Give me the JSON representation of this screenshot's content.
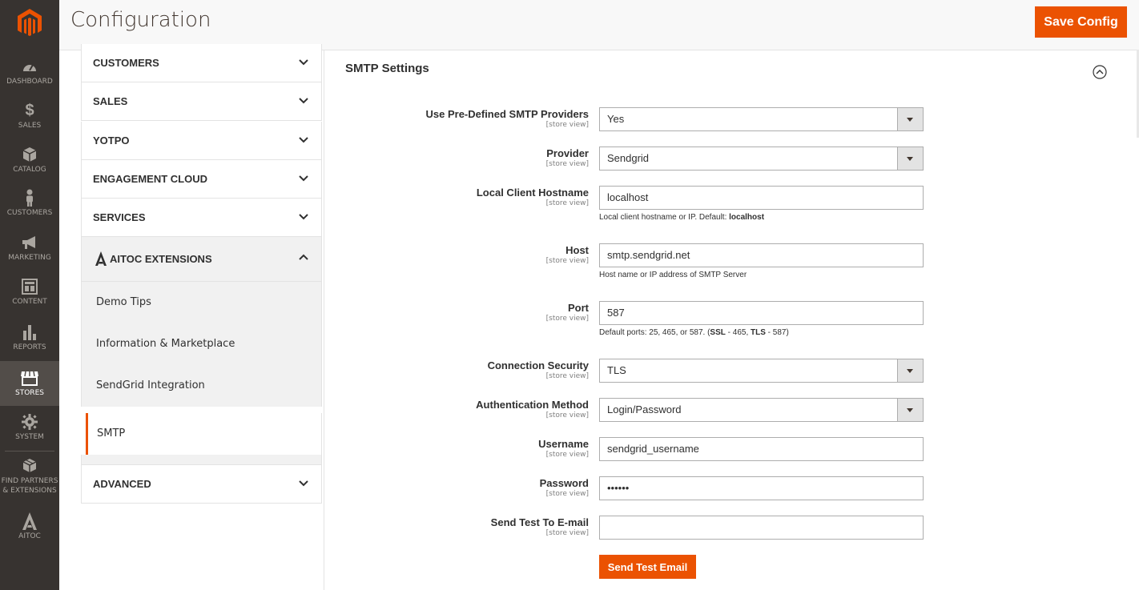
{
  "nav": {
    "items": [
      {
        "label": "DASHBOARD",
        "icon": "dashboard-icon"
      },
      {
        "label": "SALES",
        "icon": "dollar-icon"
      },
      {
        "label": "CATALOG",
        "icon": "cube-icon"
      },
      {
        "label": "CUSTOMERS",
        "icon": "person-icon"
      },
      {
        "label": "MARKETING",
        "icon": "megaphone-icon"
      },
      {
        "label": "CONTENT",
        "icon": "layout-icon"
      },
      {
        "label": "REPORTS",
        "icon": "bar-chart-icon"
      },
      {
        "label": "STORES",
        "icon": "store-icon"
      },
      {
        "label": "SYSTEM",
        "icon": "gear-icon"
      },
      {
        "label": "FIND PARTNERS & EXTENSIONS",
        "icon": "boxes-icon"
      },
      {
        "label": "AITOC",
        "icon": "aitoc-logo-icon"
      }
    ],
    "active": "STORES"
  },
  "header": {
    "title": "Configuration",
    "save_label": "Save Config"
  },
  "tabs": {
    "groups": [
      {
        "label": "CUSTOMERS",
        "state": "collapsed"
      },
      {
        "label": "SALES",
        "state": "collapsed"
      },
      {
        "label": "YOTPO",
        "state": "collapsed"
      },
      {
        "label": "ENGAGEMENT CLOUD",
        "state": "collapsed"
      },
      {
        "label": "SERVICES",
        "state": "collapsed"
      },
      {
        "label": "AITOC EXTENSIONS",
        "state": "expanded"
      },
      {
        "label": "ADVANCED",
        "state": "collapsed"
      }
    ],
    "aitoc_items": [
      {
        "label": "Demo Tips"
      },
      {
        "label": "Information & Marketplace"
      },
      {
        "label": "SendGrid Integration"
      },
      {
        "label": "SMTP"
      }
    ],
    "current": "SMTP"
  },
  "section": {
    "title": "SMTP Settings"
  },
  "fields": [
    {
      "label": "Use Pre-Defined SMTP Providers",
      "scope": "[store view]",
      "type": "select",
      "value": "Yes"
    },
    {
      "label": "Provider",
      "scope": "[store view]",
      "type": "select",
      "value": "Sendgrid"
    },
    {
      "label": "Local Client Hostname",
      "scope": "[store view]",
      "type": "text",
      "value": "localhost"
    },
    {
      "label": "Host",
      "scope": "[store view]",
      "type": "text",
      "value": "smtp.sendgrid.net"
    },
    {
      "label": "Port",
      "scope": "[store view]",
      "type": "text",
      "value": "587"
    },
    {
      "label": "Connection Security",
      "scope": "[store view]",
      "type": "select",
      "value": "TLS"
    },
    {
      "label": "Authentication Method",
      "scope": "[store view]",
      "type": "select",
      "value": "Login/Password"
    },
    {
      "label": "Username",
      "scope": "[store view]",
      "type": "text",
      "value": "sendgrid_username"
    },
    {
      "label": "Password",
      "scope": "[store view]",
      "type": "password",
      "value": "••••••"
    },
    {
      "label": "Send Test To E-mail",
      "scope": "[store view]",
      "type": "text",
      "value": ""
    }
  ],
  "notes": {
    "hostname_pre": "Local client hostname or IP. Default: ",
    "hostname_bold": "localhost",
    "host": "Host name or IP address of SMTP Server",
    "port_pre": "Default ports: 25, 465, or 587. (",
    "port_ssl": "SSL",
    "port_mid": " - 465, ",
    "port_tls": "TLS",
    "port_end": " - 587)"
  },
  "test_button_label": "Send Test Email",
  "colors": {
    "accent": "#eb5202",
    "nav_bg": "#373330",
    "nav_active": "#524d49"
  }
}
